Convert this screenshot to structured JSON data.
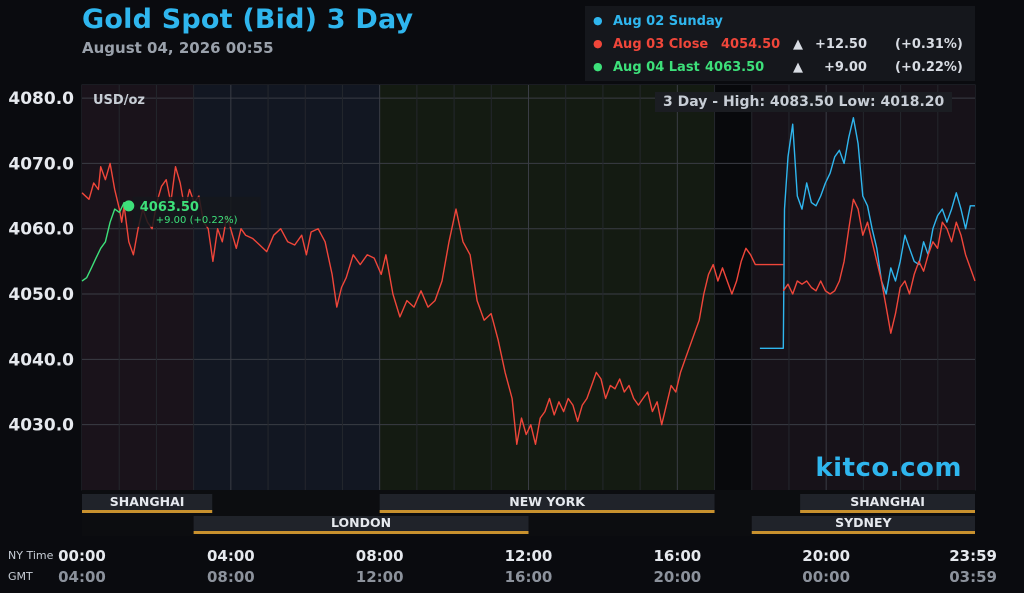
{
  "title": "Gold Spot (Bid) 3 Day",
  "timestamp": "August 04, 2026 00:55",
  "legend": [
    {
      "label": "Aug 02 Sunday",
      "price": "",
      "arrow": "",
      "change": "",
      "pct": "",
      "color": "#2fb6ee"
    },
    {
      "label": "Aug 03 Close",
      "price": "4054.50",
      "arrow": "▲",
      "change": "+12.50",
      "pct": "(+0.31%)",
      "color": "#f0463a"
    },
    {
      "label": "Aug 04 Last",
      "price": "4063.50",
      "arrow": "▲",
      "change": "+9.00",
      "pct": "(+0.22%)",
      "color": "#3de07a"
    }
  ],
  "unit_label": "USD/oz",
  "range_label": "3 Day - High: 4083.50  Low: 4018.20",
  "last_marker": {
    "price": "4063.50",
    "change": "+9.00 (+0.22%)"
  },
  "watermark": "kitco.com",
  "sessions_top": [
    {
      "name": "SHANGHAI",
      "start": 0,
      "end": 3.5
    },
    {
      "name": "NEW YORK",
      "start": 8,
      "end": 17
    },
    {
      "name": "SHANGHAI",
      "start": 19.3,
      "end": 24
    }
  ],
  "sessions_bottom": [
    {
      "name": "LONDON",
      "start": 3,
      "end": 12
    },
    {
      "name": "SYDNEY",
      "start": 18,
      "end": 24
    }
  ],
  "time_axis": {
    "row1_label": "NY Time",
    "row2_label": "GMT",
    "ny": [
      "00:00",
      "04:00",
      "08:00",
      "12:00",
      "16:00",
      "20:00",
      "23:59"
    ],
    "gmt": [
      "04:00",
      "08:00",
      "12:00",
      "16:00",
      "20:00",
      "00:00",
      "03:59"
    ]
  },
  "chart_data": {
    "type": "line",
    "title": "Gold Spot (Bid) 3 Day",
    "ylabel": "USD/oz",
    "xlabel": "NY Time",
    "ylim": [
      4020,
      4082
    ],
    "xlim": [
      0,
      24
    ],
    "y_ticks": [
      "4080.0",
      "4070.0",
      "4060.0",
      "4050.0",
      "4040.0",
      "4030.0"
    ],
    "y_tick_values": [
      4080,
      4070,
      4060,
      4050,
      4040,
      4030
    ],
    "grid": true,
    "series": [
      {
        "name": "Aug 03 Close",
        "color": "#f0463a",
        "points": [
          [
            0.0,
            4065.5
          ],
          [
            0.3,
            4064.5
          ],
          [
            0.5,
            4067
          ],
          [
            0.7,
            4066
          ],
          [
            0.8,
            4069.5
          ],
          [
            1.0,
            4067.5
          ],
          [
            1.2,
            4070
          ],
          [
            1.4,
            4066
          ],
          [
            1.6,
            4063
          ],
          [
            1.7,
            4061
          ],
          [
            1.8,
            4063.5
          ],
          [
            2.0,
            4058
          ],
          [
            2.2,
            4056
          ],
          [
            2.4,
            4060
          ],
          [
            2.6,
            4063
          ],
          [
            2.8,
            4061
          ],
          [
            3.0,
            4060
          ],
          [
            3.2,
            4064
          ],
          [
            3.4,
            4066.5
          ],
          [
            3.6,
            4067.5
          ],
          [
            3.8,
            4064
          ],
          [
            4.0,
            4069.5
          ],
          [
            4.2,
            4067
          ],
          [
            4.4,
            4063
          ],
          [
            4.6,
            4066
          ],
          [
            4.8,
            4064
          ],
          [
            5.0,
            4065
          ],
          [
            5.2,
            4061
          ],
          [
            5.4,
            4060
          ],
          [
            5.6,
            4055
          ],
          [
            5.8,
            4060
          ],
          [
            6.0,
            4058
          ],
          [
            6.2,
            4062
          ],
          [
            6.4,
            4059.5
          ],
          [
            6.6,
            4057
          ],
          [
            6.8,
            4060
          ],
          [
            7.0,
            4059
          ],
          [
            7.3,
            4058.5
          ],
          [
            7.6,
            4057.5
          ],
          [
            7.9,
            4056.5
          ],
          [
            8.2,
            4059
          ],
          [
            8.5,
            4060
          ],
          [
            8.8,
            4058
          ],
          [
            9.1,
            4057.5
          ],
          [
            9.4,
            4059
          ],
          [
            9.6,
            4056
          ],
          [
            9.8,
            4059.5
          ],
          [
            10.1,
            4060
          ],
          [
            10.4,
            4058
          ],
          [
            10.7,
            4053
          ],
          [
            10.9,
            4048
          ],
          [
            11.1,
            4051
          ],
          [
            11.3,
            4052.5
          ],
          [
            11.6,
            4056
          ],
          [
            11.9,
            4054.5
          ],
          [
            12.2,
            4056
          ],
          [
            12.5,
            4055.5
          ],
          [
            12.8,
            4053
          ],
          [
            13.0,
            4056
          ],
          [
            13.3,
            4050
          ],
          [
            13.6,
            4046.5
          ],
          [
            13.9,
            4049
          ],
          [
            14.2,
            4048
          ],
          [
            14.5,
            4050.5
          ],
          [
            14.8,
            4048
          ],
          [
            15.1,
            4049
          ],
          [
            15.4,
            4052
          ],
          [
            15.7,
            4058
          ],
          [
            16.0,
            4063
          ],
          [
            16.3,
            4058
          ],
          [
            16.6,
            4056
          ],
          [
            16.9,
            4049
          ],
          [
            17.2,
            4046
          ],
          [
            17.5,
            4047
          ],
          [
            17.8,
            4043
          ],
          [
            18.1,
            4038
          ],
          [
            18.4,
            4034
          ],
          [
            18.6,
            4027
          ],
          [
            18.8,
            4031
          ],
          [
            19.0,
            4028.5
          ],
          [
            19.2,
            4030
          ],
          [
            19.4,
            4027
          ],
          [
            19.6,
            4031
          ],
          [
            19.8,
            4032
          ],
          [
            20.0,
            4034
          ],
          [
            20.2,
            4031.5
          ],
          [
            20.4,
            4033.5
          ],
          [
            20.6,
            4032
          ],
          [
            20.8,
            4034
          ],
          [
            21.0,
            4033
          ],
          [
            21.2,
            4030.5
          ],
          [
            21.4,
            4033
          ],
          [
            21.6,
            4034
          ],
          [
            21.8,
            4036
          ],
          [
            22.0,
            4038
          ],
          [
            22.2,
            4037
          ],
          [
            22.4,
            4034
          ],
          [
            22.6,
            4036
          ],
          [
            22.8,
            4035.5
          ],
          [
            23.0,
            4037
          ],
          [
            23.2,
            4035
          ],
          [
            23.4,
            4036
          ],
          [
            23.6,
            4034
          ],
          [
            23.8,
            4033
          ],
          [
            24.0,
            4034
          ],
          [
            24.2,
            4035
          ],
          [
            24.4,
            4032
          ],
          [
            24.6,
            4033.5
          ],
          [
            24.8,
            4030
          ],
          [
            25.0,
            4033
          ],
          [
            25.2,
            4036
          ],
          [
            25.4,
            4035
          ],
          [
            25.6,
            4038
          ],
          [
            25.8,
            4040
          ],
          [
            26.0,
            4042
          ],
          [
            26.2,
            4044
          ],
          [
            26.4,
            4046
          ],
          [
            26.6,
            4050
          ],
          [
            26.8,
            4053
          ],
          [
            27.0,
            4054.5
          ],
          [
            27.2,
            4052
          ],
          [
            27.4,
            4054
          ],
          [
            27.6,
            4052
          ],
          [
            27.8,
            4050
          ],
          [
            28.0,
            4052
          ],
          [
            28.2,
            4055
          ],
          [
            28.4,
            4057
          ],
          [
            28.6,
            4056
          ],
          [
            28.8,
            4054.5
          ],
          [
            29.0,
            4054.5
          ],
          [
            29.3,
            4054.5
          ],
          [
            29.6,
            4054.5
          ],
          [
            30.0,
            4054.5
          ]
        ]
      },
      {
        "name": "Aug 02 Sunday",
        "color": "#2fb6ee",
        "points": [
          [
            29.0,
            4041.7
          ],
          [
            30.0,
            4041.7
          ],
          [
            30.05,
            4063
          ],
          [
            30.2,
            4071
          ],
          [
            30.4,
            4076
          ],
          [
            30.6,
            4065
          ],
          [
            30.8,
            4063
          ],
          [
            31.0,
            4067
          ],
          [
            31.2,
            4064
          ],
          [
            31.4,
            4063.5
          ],
          [
            31.6,
            4065
          ],
          [
            31.8,
            4067
          ],
          [
            32.0,
            4068.5
          ],
          [
            32.2,
            4071
          ],
          [
            32.4,
            4072
          ],
          [
            32.6,
            4070
          ],
          [
            32.8,
            4074
          ],
          [
            33.0,
            4077
          ],
          [
            33.2,
            4073
          ],
          [
            33.4,
            4065
          ],
          [
            33.6,
            4063.5
          ],
          [
            33.8,
            4060
          ],
          [
            34.0,
            4057
          ],
          [
            34.2,
            4052
          ],
          [
            34.4,
            4050
          ],
          [
            34.6,
            4054
          ],
          [
            34.8,
            4052
          ],
          [
            35.0,
            4055
          ],
          [
            35.2,
            4059
          ],
          [
            35.4,
            4057
          ],
          [
            35.6,
            4055
          ],
          [
            35.8,
            4054.5
          ],
          [
            36.0,
            4058
          ],
          [
            36.2,
            4056
          ],
          [
            36.4,
            4060
          ],
          [
            36.6,
            4062
          ],
          [
            36.8,
            4063
          ],
          [
            37.0,
            4061
          ],
          [
            37.2,
            4063
          ],
          [
            37.4,
            4065.5
          ],
          [
            37.6,
            4063
          ],
          [
            37.8,
            4060
          ],
          [
            38.0,
            4063.5
          ],
          [
            38.2,
            4063.5
          ]
        ]
      },
      {
        "name": "Aug 03 Close (overnight)",
        "color": "#f0463a",
        "points": [
          [
            30.0,
            4050.5
          ],
          [
            30.2,
            4051.5
          ],
          [
            30.4,
            4050
          ],
          [
            30.6,
            4052
          ],
          [
            30.8,
            4051.5
          ],
          [
            31.0,
            4052
          ],
          [
            31.2,
            4051
          ],
          [
            31.4,
            4050.5
          ],
          [
            31.6,
            4052
          ],
          [
            31.8,
            4050.5
          ],
          [
            32.0,
            4050
          ],
          [
            32.2,
            4050.5
          ],
          [
            32.4,
            4052
          ],
          [
            32.6,
            4055
          ],
          [
            32.8,
            4060
          ],
          [
            33.0,
            4064.5
          ],
          [
            33.2,
            4063
          ],
          [
            33.4,
            4059
          ],
          [
            33.6,
            4061
          ],
          [
            33.8,
            4058
          ],
          [
            34.0,
            4055
          ],
          [
            34.2,
            4052
          ],
          [
            34.4,
            4048
          ],
          [
            34.6,
            4044
          ],
          [
            34.8,
            4047
          ],
          [
            35.0,
            4051
          ],
          [
            35.2,
            4052
          ],
          [
            35.4,
            4050
          ],
          [
            35.6,
            4053
          ],
          [
            35.8,
            4055
          ],
          [
            36.0,
            4053.5
          ],
          [
            36.2,
            4056
          ],
          [
            36.4,
            4058
          ],
          [
            36.6,
            4057
          ],
          [
            36.8,
            4061
          ],
          [
            37.0,
            4060
          ],
          [
            37.2,
            4058
          ],
          [
            37.4,
            4061
          ],
          [
            37.6,
            4059
          ],
          [
            37.8,
            4056
          ],
          [
            38.0,
            4054
          ],
          [
            38.2,
            4052
          ]
        ]
      },
      {
        "name": "Aug 04 Last",
        "color": "#3de07a",
        "points": [
          [
            0.0,
            4052
          ],
          [
            0.2,
            4052.5
          ],
          [
            0.4,
            4054
          ],
          [
            0.6,
            4055.5
          ],
          [
            0.8,
            4057
          ],
          [
            1.0,
            4058
          ],
          [
            1.2,
            4061
          ],
          [
            1.4,
            4063
          ],
          [
            1.6,
            4062.5
          ],
          [
            1.8,
            4064
          ],
          [
            2.0,
            4063.5
          ]
        ]
      }
    ]
  }
}
